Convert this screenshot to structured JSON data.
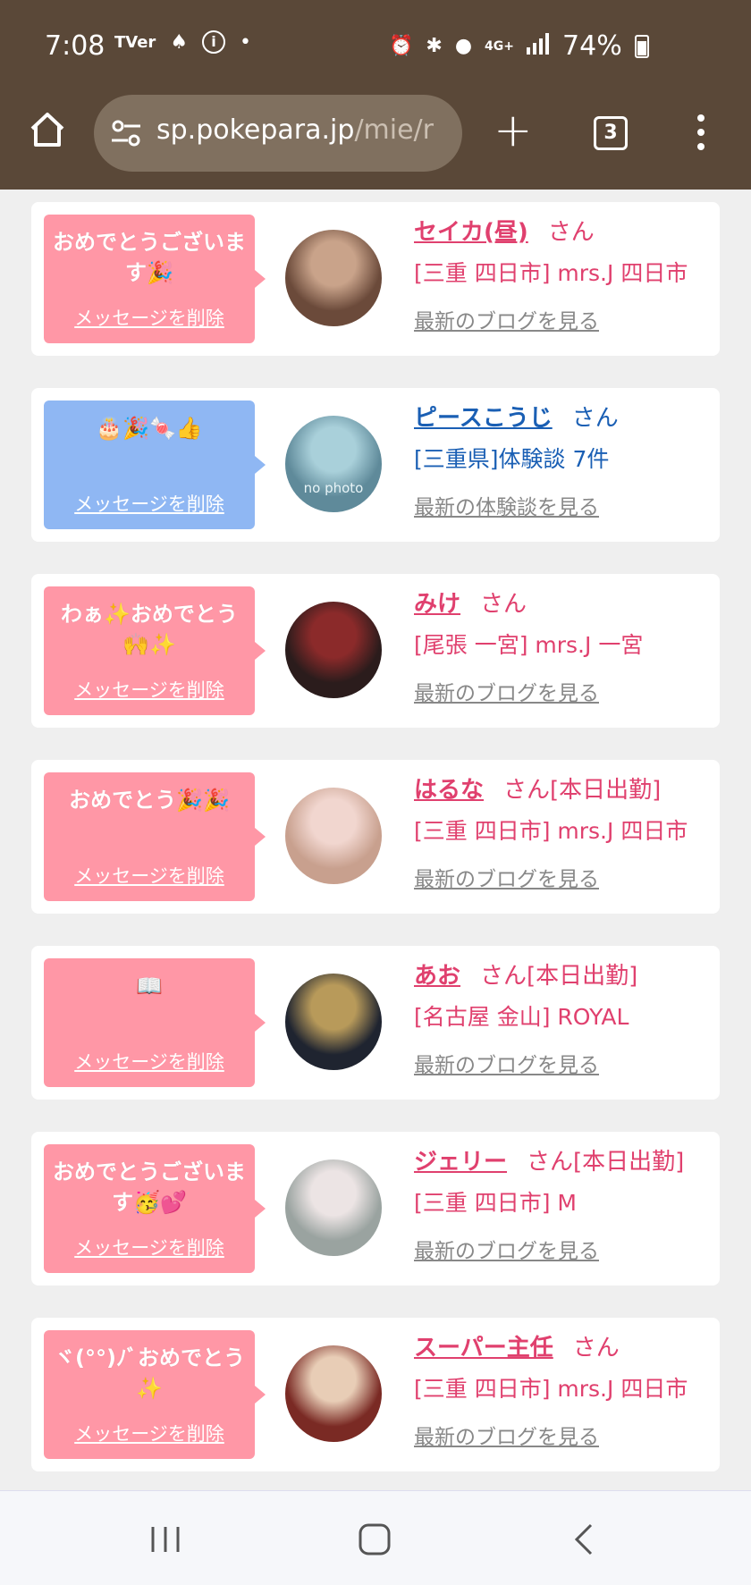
{
  "status_bar": {
    "time": "7:08",
    "left_icons": [
      "tver-icon",
      "android-assistant-icon",
      "info-icon",
      "dot-icon"
    ],
    "right_icons": [
      "alarm-icon",
      "bluetooth-icon",
      "location-icon",
      "network-4g-icon",
      "signal-icon"
    ],
    "network": "4G+",
    "battery": "74%"
  },
  "browser": {
    "url_host": "sp.pokepara.jp",
    "url_path": "/mie/r",
    "tab_count": "3"
  },
  "delete_label": "メッセージを削除",
  "cards": [
    {
      "message": "おめでとうございます🎉",
      "name": "セイカ(昼)",
      "suffix": "さん",
      "shop": "[三重 四日市] mrs.J 四日市",
      "link": "最新のブログを見る",
      "bubble": "pink",
      "name_color": "pink",
      "avatar_colors": [
        "#6b4a3a",
        "#c9a38a"
      ]
    },
    {
      "message": "🎂🎉🍬👍",
      "name": "ピースこうじ",
      "suffix": "さん",
      "shop": "[三重県]体験談 7件",
      "link": "最新の体験談を見る",
      "bubble": "blue",
      "name_color": "blue",
      "avatar_colors": [
        "#5f8a9a",
        "#a9d0da"
      ],
      "avatar_text": "no photo"
    },
    {
      "message": "わぁ✨おめでとう🙌✨",
      "name": "みけ",
      "suffix": "さん",
      "shop": "[尾張 一宮] mrs.J 一宮",
      "link": "最新のブログを見る",
      "bubble": "pink",
      "name_color": "pink",
      "avatar_colors": [
        "#2b1c1c",
        "#8b2a2a"
      ]
    },
    {
      "message": "おめでとう🎉🎉",
      "name": "はるな",
      "suffix": "さん[本日出勤]",
      "shop": "[三重 四日市] mrs.J 四日市",
      "link": "最新のブログを見る",
      "bubble": "pink",
      "name_color": "pink",
      "avatar_colors": [
        "#c8a08e",
        "#f1d6cf"
      ]
    },
    {
      "message": "📖",
      "name": "あお",
      "suffix": "さん[本日出勤]",
      "shop": "[名古屋 金山] ROYAL",
      "link": "最新のブログを見る",
      "bubble": "pink",
      "name_color": "pink",
      "avatar_colors": [
        "#1f2430",
        "#b89a5a"
      ]
    },
    {
      "message": "おめでとうございます🥳💕",
      "name": "ジェリー",
      "suffix": "さん[本日出勤]",
      "shop": "[三重 四日市] M",
      "link": "最新のブログを見る",
      "bubble": "pink",
      "name_color": "pink",
      "avatar_colors": [
        "#9aa3a0",
        "#ece4e4"
      ]
    },
    {
      "message": "ヾ(°°)ﾉﾞおめでとう✨",
      "name": "スーパー主任",
      "suffix": "さん",
      "shop": "[三重 四日市] mrs.J 四日市",
      "link": "最新のブログを見る",
      "bubble": "pink",
      "name_color": "pink",
      "avatar_colors": [
        "#7a2a24",
        "#e8cdb6"
      ]
    }
  ],
  "nav_buttons": [
    "recents-button",
    "home-button",
    "back-button"
  ]
}
